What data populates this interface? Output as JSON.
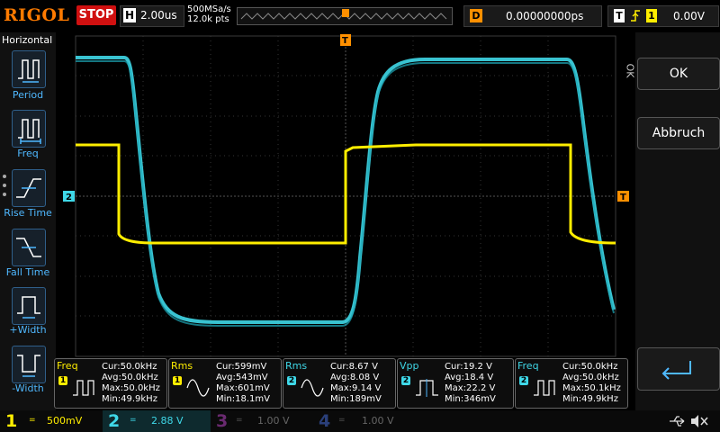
{
  "brand": "RIGOL",
  "run_state": "STOP",
  "timebase": {
    "letter": "H",
    "value": "2.00us",
    "sample_rate": "500MSa/s",
    "points": "12.0k pts"
  },
  "delay": {
    "letter": "D",
    "value": "0.00000000ps"
  },
  "trigger": {
    "letter": "T",
    "source": "1",
    "level": "0.00V"
  },
  "left_menu": {
    "title": "Horizontal",
    "items": [
      {
        "label": "Period"
      },
      {
        "label": "Freq"
      },
      {
        "label": "Rise Time"
      },
      {
        "label": "Fall Time"
      },
      {
        "label": "+Width"
      },
      {
        "label": "-Width"
      }
    ]
  },
  "right_menu": {
    "ok": "OK",
    "cancel": "Abbruch",
    "ok_side": "OK"
  },
  "markers": {
    "ch2": "2",
    "trigger_top": "T",
    "trigger_right": "T"
  },
  "measurements": [
    {
      "name": "Freq",
      "ch": "1",
      "cur": "Cur:50.0kHz",
      "avg": "Avg:50.0kHz",
      "max": "Max:50.0kHz",
      "min": "Min:49.9kHz"
    },
    {
      "name": "Rms",
      "ch": "1",
      "cur": "Cur:599mV",
      "avg": "Avg:543mV",
      "max": "Max:601mV",
      "min": "Min:18.1mV"
    },
    {
      "name": "Rms",
      "ch": "2",
      "cur": "Cur:8.67 V",
      "avg": "Avg:8.08 V",
      "max": "Max:9.14 V",
      "min": "Min:189mV"
    },
    {
      "name": "Vpp",
      "ch": "2",
      "cur": "Cur:19.2 V",
      "avg": "Avg:18.4 V",
      "max": "Max:22.2 V",
      "min": "Min:346mV"
    },
    {
      "name": "Freq",
      "ch": "2",
      "cur": "Cur:50.0kHz",
      "avg": "Avg:50.0kHz",
      "max": "Max:50.1kHz",
      "min": "Min:49.9kHz"
    }
  ],
  "channels": [
    {
      "num": "1",
      "scale": "500mV",
      "color": "#ffee00"
    },
    {
      "num": "2",
      "scale": "2.88 V",
      "color": "#00e5ff"
    },
    {
      "num": "3",
      "scale": "1.00 V",
      "color": "#d12be0"
    },
    {
      "num": "4",
      "scale": "1.00 V",
      "color": "#2b6cff"
    }
  ],
  "colors": {
    "ch1": "#ffee00",
    "ch2": "#3fd8e8",
    "trigger": "#ff9000",
    "accent_blue": "#4fb8ff"
  }
}
